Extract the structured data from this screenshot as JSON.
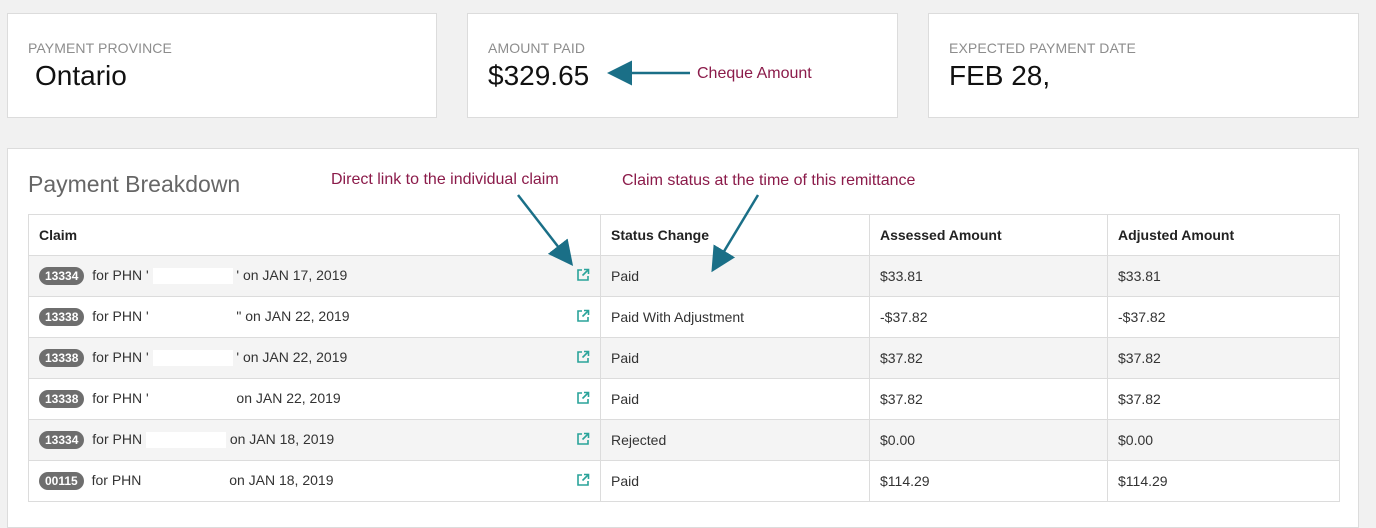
{
  "cards": {
    "province": {
      "label": "PAYMENT PROVINCE",
      "value": "Ontario"
    },
    "amount": {
      "label": "AMOUNT PAID",
      "value": "$329.65"
    },
    "date": {
      "label": "EXPECTED PAYMENT DATE",
      "value": "FEB 28,"
    }
  },
  "annotations": {
    "cheque": "Cheque Amount",
    "direct_link": "Direct link to the individual claim",
    "claim_status": "Claim status at the time of this remittance"
  },
  "breakdown": {
    "title": "Payment Breakdown",
    "columns": [
      "Claim",
      "Status Change",
      "Assessed Amount",
      "Adjusted Amount"
    ],
    "rows": [
      {
        "claim_id": "13334",
        "phn_prefix": "for PHN '",
        "phn_suffix": "' on JAN 17, 2019",
        "status": "Paid",
        "assessed": "$33.81",
        "adjusted": "$33.81"
      },
      {
        "claim_id": "13338",
        "phn_prefix": "for PHN '",
        "phn_suffix": "\" on JAN 22, 2019",
        "status": "Paid With Adjustment",
        "assessed": "-$37.82",
        "adjusted": "-$37.82"
      },
      {
        "claim_id": "13338",
        "phn_prefix": "for PHN '",
        "phn_suffix": "' on JAN 22, 2019",
        "status": "Paid",
        "assessed": "$37.82",
        "adjusted": "$37.82"
      },
      {
        "claim_id": "13338",
        "phn_prefix": "for PHN '",
        "phn_suffix": "on JAN 22, 2019",
        "status": "Paid",
        "assessed": "$37.82",
        "adjusted": "$37.82"
      },
      {
        "claim_id": "13334",
        "phn_prefix": "for PHN",
        "phn_suffix": "on JAN 18, 2019",
        "status": "Rejected",
        "assessed": "$0.00",
        "adjusted": "$0.00"
      },
      {
        "claim_id": "00115",
        "phn_prefix": "for PHN",
        "phn_suffix": "on JAN 18, 2019",
        "status": "Paid",
        "assessed": "$114.29",
        "adjusted": "$114.29"
      }
    ]
  },
  "colors": {
    "annotation": "#8b1b4a",
    "arrow": "#1a6f87",
    "link_icon": "#2aa39a",
    "badge": "#6e6e6e"
  },
  "icons": {
    "row_link": "external-link-icon"
  }
}
